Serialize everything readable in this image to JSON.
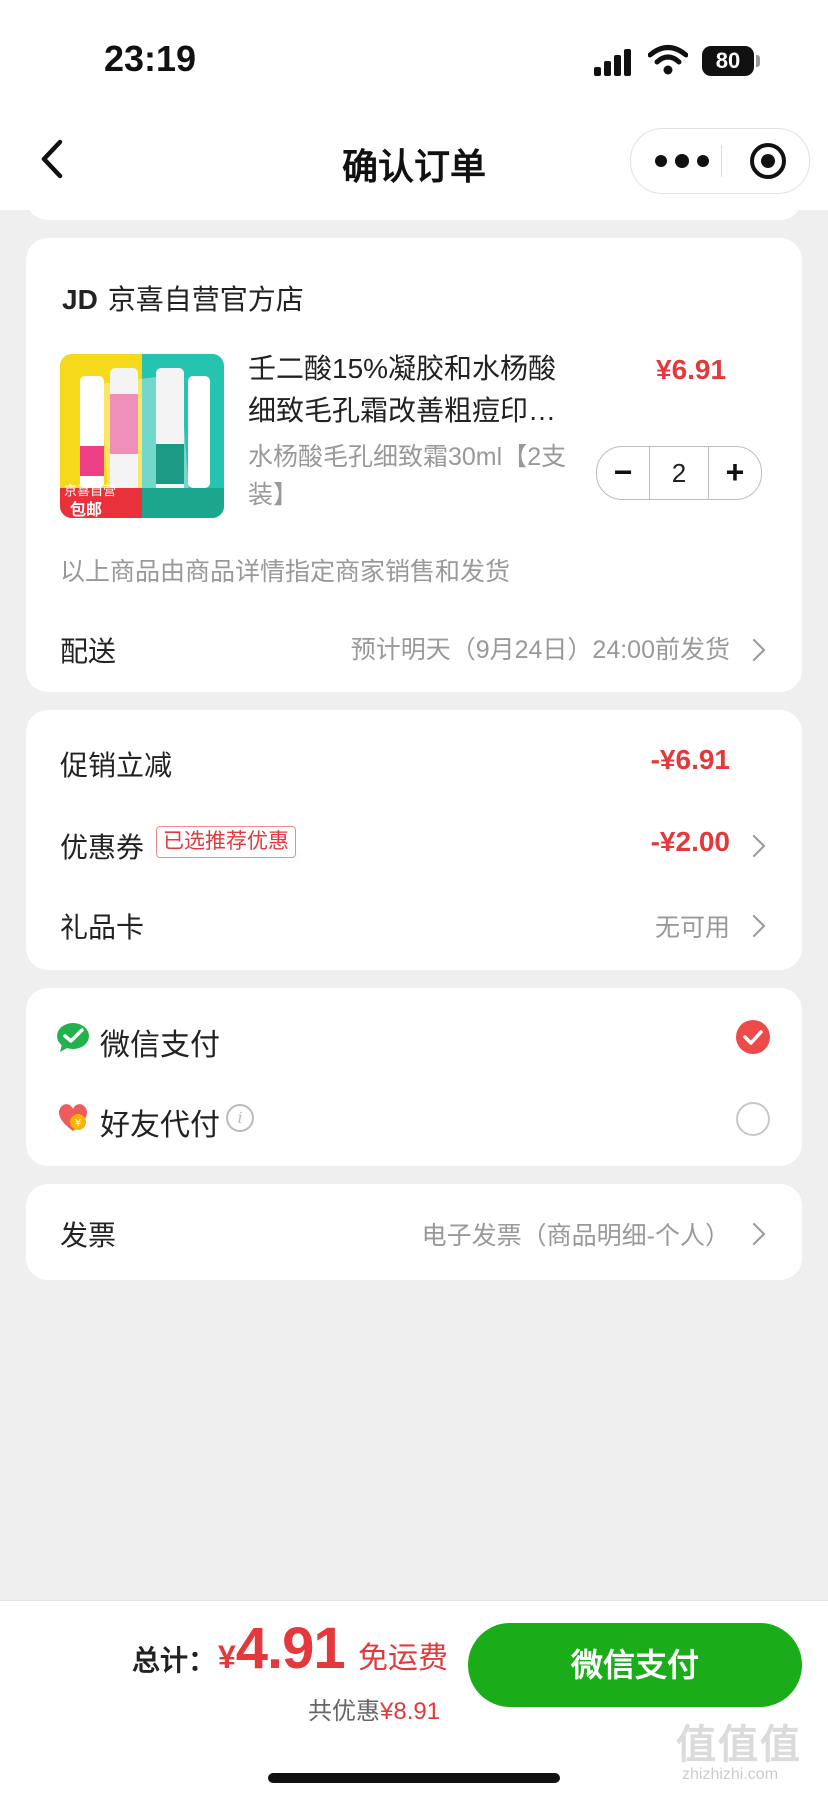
{
  "status_bar": {
    "time": "23:19",
    "battery": "80"
  },
  "nav": {
    "title": "确认订单"
  },
  "shop": {
    "logo_text": "JD",
    "name": "京喜自营官方店",
    "product": {
      "title_line1": "壬二酸15%凝胶和水杨酸",
      "title_line2": "细致毛孔霜改善粗痘印…",
      "price": "¥6.91",
      "spec_line1": "水杨酸毛孔细致霜30ml【2支",
      "spec_line2": "装】",
      "quantity": "2",
      "img_badge_top": "京喜自营",
      "img_badge_bottom": "包邮"
    },
    "seller_note": "以上商品由商品详情指定商家销售和发货",
    "delivery": {
      "label": "配送",
      "value": "预计明天（9月24日）24:00前发货"
    }
  },
  "discounts": {
    "promo": {
      "label": "促销立减",
      "value": "-¥6.91"
    },
    "coupon": {
      "label": "优惠券",
      "tag": "已选推荐优惠",
      "value": "-¥2.00"
    },
    "giftcard": {
      "label": "礼品卡",
      "value": "无可用"
    }
  },
  "payment": {
    "wechat": {
      "label": "微信支付",
      "selected": true
    },
    "friend": {
      "label": "好友代付",
      "selected": false
    }
  },
  "invoice": {
    "label": "发票",
    "value": "电子发票（商品明细-个人）"
  },
  "footer": {
    "total_label": "总计：",
    "currency": "¥",
    "total": "4.91",
    "shipping": "免运费",
    "discount_prefix": "共优惠",
    "discount_amount": "¥8.91",
    "pay_button": "微信支付"
  },
  "watermark": {
    "main": "值值值",
    "sub": "zhizhizhi.com"
  },
  "colors": {
    "accent_red": "#e4393c",
    "wechat_green": "#1aad19",
    "check_red": "#ee4a4a"
  }
}
